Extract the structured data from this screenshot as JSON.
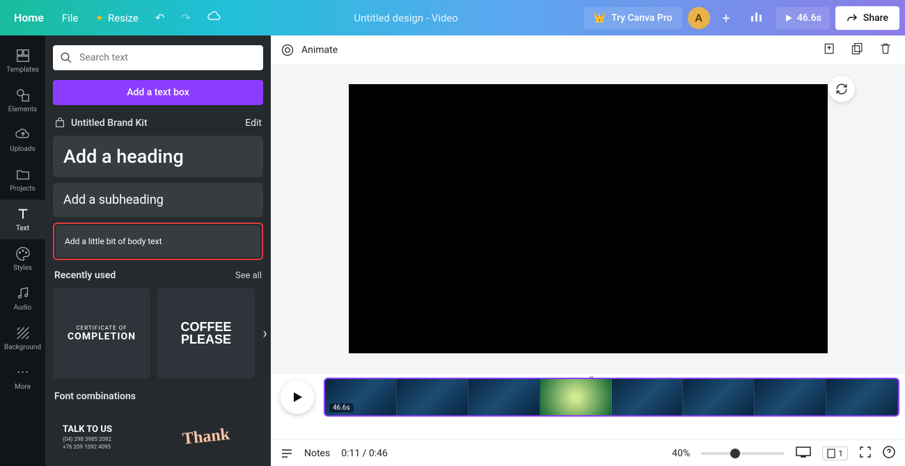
{
  "topbar": {
    "home": "Home",
    "file": "File",
    "resize": "Resize",
    "title": "Untitled design - Video",
    "try_pro": "Try Canva Pro",
    "avatar_initial": "A",
    "duration": "46.6s",
    "share": "Share"
  },
  "rail": {
    "templates": "Templates",
    "elements": "Elements",
    "uploads": "Uploads",
    "projects": "Projects",
    "text": "Text",
    "styles": "Styles",
    "audio": "Audio",
    "background": "Background",
    "more": "More"
  },
  "panel": {
    "search_placeholder": "Search text",
    "add_text_box": "Add a text box",
    "brand_kit": "Untitled Brand Kit",
    "edit": "Edit",
    "heading": "Add a heading",
    "subheading": "Add a subheading",
    "body": "Add a little bit of body text",
    "recently_used": "Recently used",
    "see_all": "See all",
    "thumb1_l1": "CERTIFICATE OF",
    "thumb1_l2": "COMPLETION",
    "thumb2_l1": "COFFEE",
    "thumb2_l2": "PLEASE",
    "font_combinations": "Font combinations",
    "combo1_t1": "TALK TO US",
    "combo1_t2": "(04) 298 3985 2092",
    "combo1_t3": "+76 209 1092 4095",
    "combo2_t1": "Thank"
  },
  "canvas": {
    "animate": "Animate"
  },
  "timeline": {
    "clip_duration": "46.6s"
  },
  "bottom": {
    "notes": "Notes",
    "time": "0:11 / 0:46",
    "zoom": "40%",
    "page_num": "1"
  }
}
